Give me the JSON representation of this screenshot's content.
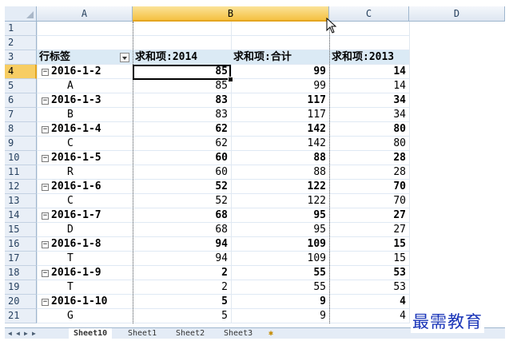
{
  "columns": [
    "A",
    "B",
    "C",
    "D"
  ],
  "rows": [
    {
      "n": "1",
      "a": "",
      "b": "",
      "c": ""
    },
    {
      "n": "2",
      "a": "",
      "b": "",
      "c": ""
    },
    {
      "n": "3",
      "a": "行标签",
      "b": "求和项:2014",
      "c": "求和项:合计",
      "d": "求和项:2013"
    },
    {
      "n": "4",
      "a": "2016-1-2",
      "b": "85",
      "c": "99",
      "d": "14"
    },
    {
      "n": "5",
      "a": "A",
      "b": "85",
      "c": "99",
      "d": "14"
    },
    {
      "n": "6",
      "a": "2016-1-3",
      "b": "83",
      "c": "117",
      "d": "34"
    },
    {
      "n": "7",
      "a": "B",
      "b": "83",
      "c": "117",
      "d": "34"
    },
    {
      "n": "8",
      "a": "2016-1-4",
      "b": "62",
      "c": "142",
      "d": "80"
    },
    {
      "n": "9",
      "a": "C",
      "b": "62",
      "c": "142",
      "d": "80"
    },
    {
      "n": "10",
      "a": "2016-1-5",
      "b": "60",
      "c": "88",
      "d": "28"
    },
    {
      "n": "11",
      "a": "R",
      "b": "60",
      "c": "88",
      "d": "28"
    },
    {
      "n": "12",
      "a": "2016-1-6",
      "b": "52",
      "c": "122",
      "d": "70"
    },
    {
      "n": "13",
      "a": "C",
      "b": "52",
      "c": "122",
      "d": "70"
    },
    {
      "n": "14",
      "a": "2016-1-7",
      "b": "68",
      "c": "95",
      "d": "27"
    },
    {
      "n": "15",
      "a": "D",
      "b": "68",
      "c": "95",
      "d": "27"
    },
    {
      "n": "16",
      "a": "2016-1-8",
      "b": "94",
      "c": "109",
      "d": "15"
    },
    {
      "n": "17",
      "a": "T",
      "b": "94",
      "c": "109",
      "d": "15"
    },
    {
      "n": "18",
      "a": "2016-1-9",
      "b": "2",
      "c": "55",
      "d": "53"
    },
    {
      "n": "19",
      "a": "T",
      "b": "2",
      "c": "55",
      "d": "53"
    },
    {
      "n": "20",
      "a": "2016-1-10",
      "b": "5",
      "c": "9",
      "d": "4"
    },
    {
      "n": "21",
      "a": "G",
      "b": "5",
      "c": "9",
      "d": "4"
    }
  ],
  "selected_cell": "B4",
  "sheet_tabs": [
    "Sheet10",
    "Sheet1",
    "Sheet2",
    "Sheet3"
  ],
  "watermark": "最需教育",
  "icons": {
    "expander": "collapse-minus-icon",
    "filter": "filter-dropdown-icon",
    "cursor": "mouse-pointer-icon"
  }
}
